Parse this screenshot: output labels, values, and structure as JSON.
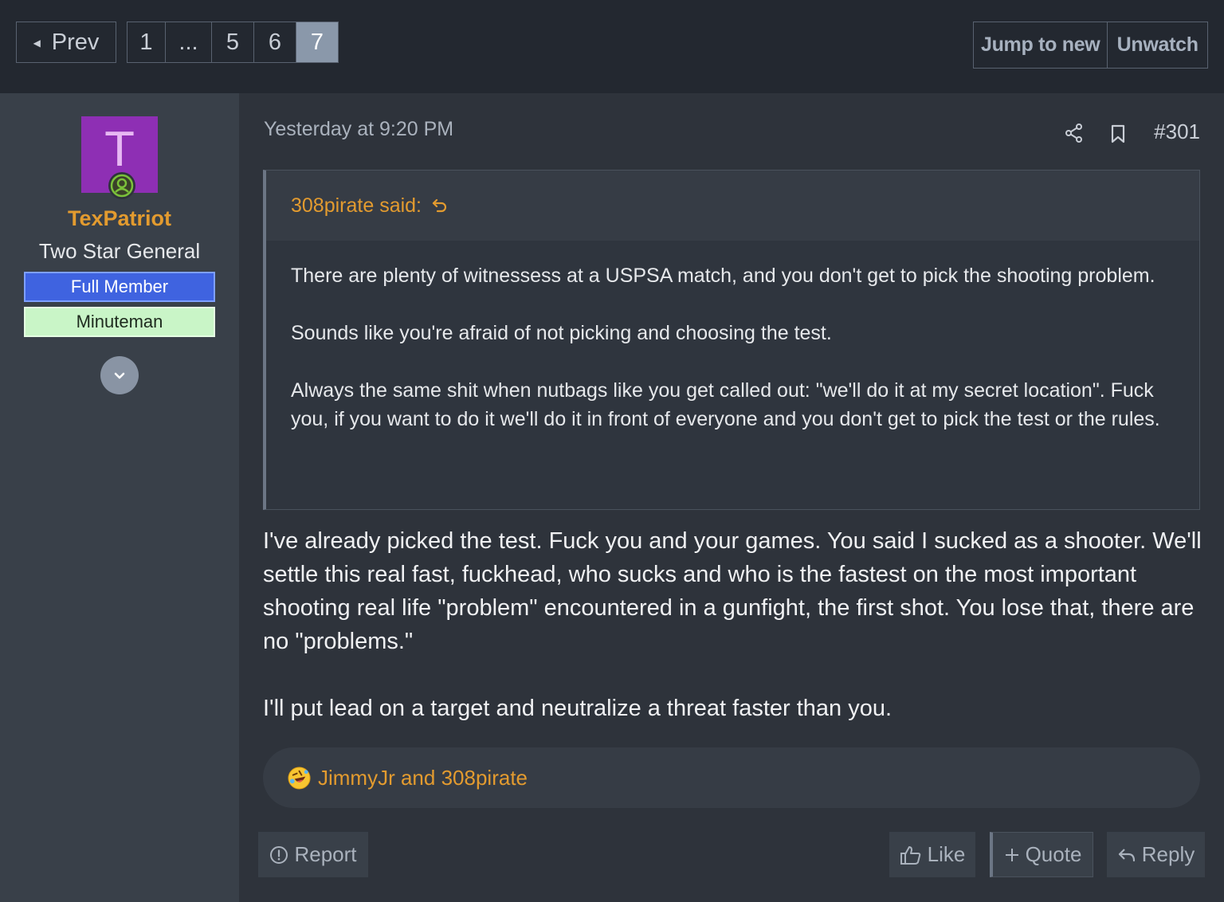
{
  "pagination": {
    "prev_label": "Prev",
    "pages": [
      "1",
      "...",
      "5",
      "6",
      "7"
    ],
    "current_page": "7"
  },
  "thread_actions": {
    "jump_label": "Jump to new",
    "unwatch_label": "Unwatch"
  },
  "user": {
    "avatar_letter": "T",
    "avatar_color": "#8e2fb4",
    "name": "TexPatriot",
    "title": "Two Star General",
    "banners": [
      "Full Member",
      "Minuteman"
    ],
    "status_icon": "online-user-icon"
  },
  "post": {
    "timestamp": "Yesterday at 9:20 PM",
    "number": "#301",
    "quote": {
      "author_line": "308pirate said:",
      "paragraphs": [
        "There are plenty of witnessess at a USPSA match, and you don't get to pick the shooting problem.",
        "Sounds like you're afraid of not picking and choosing the test.",
        "Always the same shit when nutbags like you get called out: \"we'll do it at my secret location\". Fuck you, if you want to do it we'll do it in front of everyone and you don't get to pick the test or the rules."
      ]
    },
    "body": [
      "I've already picked the test. Fuck you and your games. You said I sucked as a shooter. We'll settle this real fast, fuckhead, who sucks and who is the fastest on the most important shooting real life \"problem\" encountered in a gunfight, the first shot. You lose that, there are no \"problems.\"",
      "I'll put lead on a target and neutralize a threat faster than you."
    ],
    "reactions": {
      "emoji": "rofl-emoji",
      "names": "JimmyJr and 308pirate"
    },
    "footer": {
      "report_label": "Report",
      "like_label": "Like",
      "quote_label": "Quote",
      "reply_label": "Reply"
    }
  },
  "colors": {
    "accent": "#e39b2f",
    "current_page": "#8a98aa",
    "full_member_banner": "#3f63e0",
    "minuteman_banner": "#c9f5c7"
  }
}
